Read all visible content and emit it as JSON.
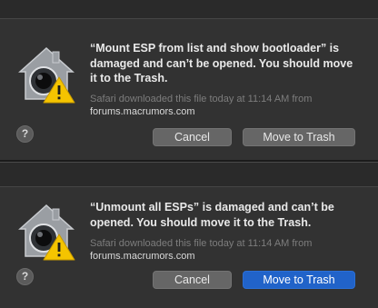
{
  "dialogs": [
    {
      "message": "“Mount ESP from list and show bootloader” is damaged and can’t be opened. You should move it to the Trash.",
      "source_prefix": "Safari downloaded this file today at 11:14 AM from",
      "source_domain": "forums.macrumors.com",
      "help_label": "?",
      "cancel_label": "Cancel",
      "trash_label": "Move to Trash",
      "default_button": "none"
    },
    {
      "message": "“Unmount all ESPs” is damaged and can’t be opened. You should move it to the Trash.",
      "source_prefix": "Safari downloaded this file today at 11:14 AM from",
      "source_domain": "forums.macrumors.com",
      "help_label": "?",
      "cancel_label": "Cancel",
      "trash_label": "Move to Trash",
      "default_button": "trash"
    }
  ],
  "colors": {
    "dialog_bg": "#323232",
    "default_button": "#2163c9",
    "warning_yellow": "#f5c400"
  },
  "icons": [
    "gatekeeper-house-icon",
    "warning-triangle-icon",
    "help-icon"
  ]
}
